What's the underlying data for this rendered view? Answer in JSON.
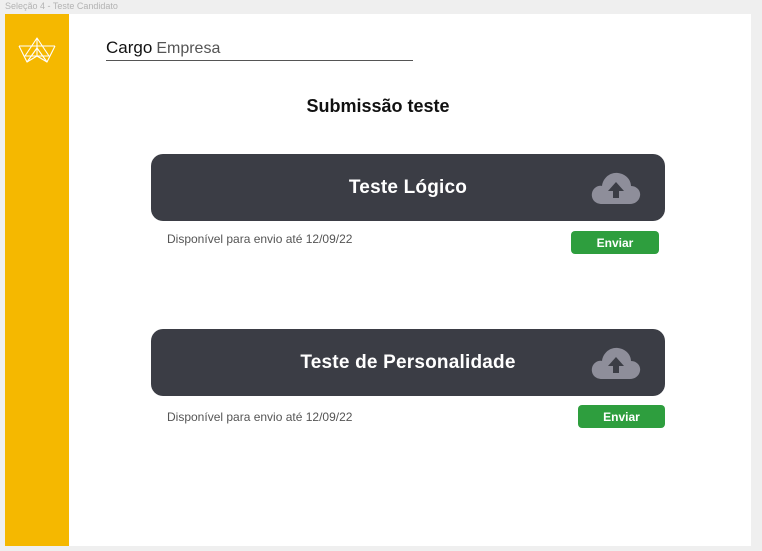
{
  "frame_label": "Seleção 4 - Teste Candidato",
  "header": {
    "cargo": "Cargo",
    "empresa": "Empresa"
  },
  "page_title": "Submissão teste",
  "tests": [
    {
      "title": "Teste  Lógico",
      "availability": "Disponível para envio até 12/09/22",
      "send_label": "Enviar",
      "upload_icon": "cloud-upload-icon"
    },
    {
      "title": "Teste  de Personalidade",
      "availability": "Disponível para envio até 12/09/22",
      "send_label": "Enviar",
      "upload_icon": "cloud-upload-icon"
    }
  ],
  "colors": {
    "sidebar": "#f5b800",
    "card": "#3b3d45",
    "button": "#2e9e3e",
    "icon": "#8e8e9a"
  }
}
